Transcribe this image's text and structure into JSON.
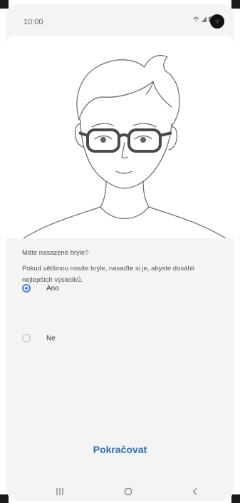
{
  "status_bar": {
    "time": "10:00",
    "icons": [
      "wifi-icon",
      "signal-icon",
      "battery-icon",
      "camera-hole"
    ]
  },
  "question": {
    "title": "Máte nasazené brýle?",
    "description": "Pokud většinou nosíte brýle, nasaďte si je, abyste dosáhli nejlepších výsledků."
  },
  "options": [
    {
      "label": "Ano",
      "selected": true
    },
    {
      "label": "Ne",
      "selected": false
    }
  ],
  "continue_label": "Pokračovat",
  "nav_bar": {
    "icons": [
      "recent-apps-icon",
      "home-icon",
      "back-icon"
    ]
  },
  "colors": {
    "accent": "#4a7ee8",
    "button_text": "#2f6fb5",
    "background": "#f4f4f4"
  }
}
